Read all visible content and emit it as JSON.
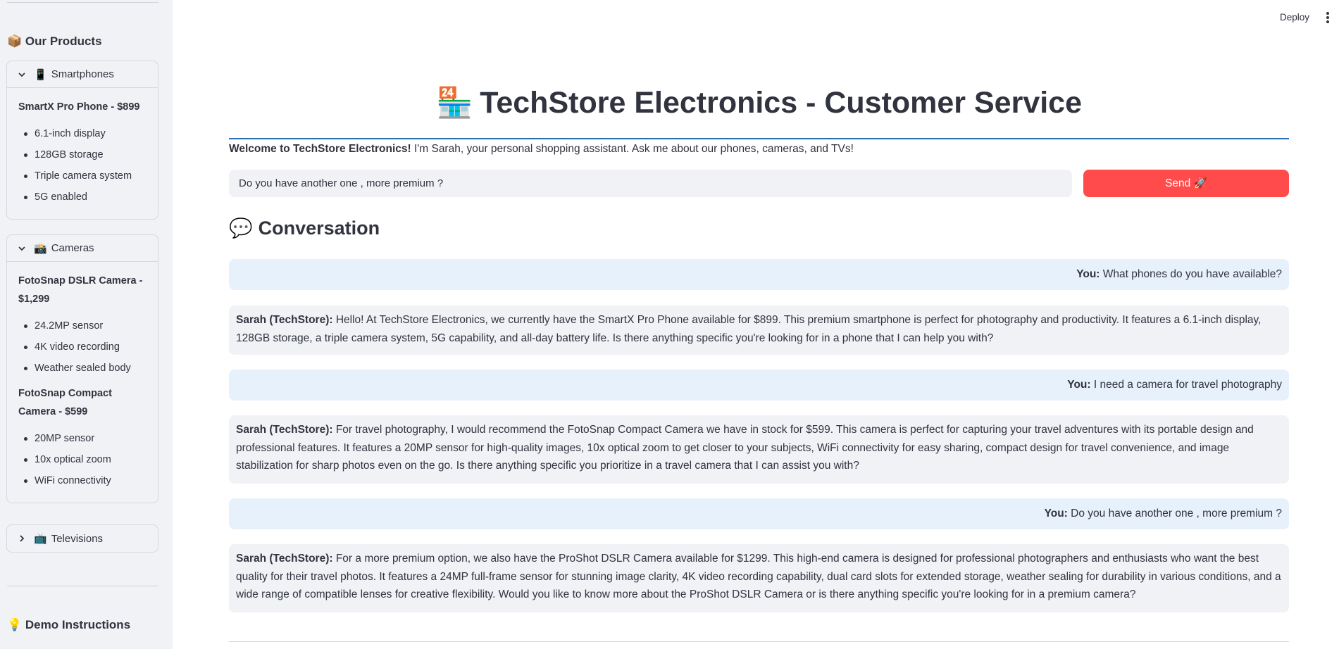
{
  "sidebar": {
    "products_heading_emoji": "📦",
    "products_heading": "Our Products",
    "expanders": [
      {
        "emoji": "📱",
        "label": "Smartphones",
        "expanded": true,
        "products": [
          {
            "title": "SmartX Pro Phone - $899",
            "features": [
              "6.1-inch display",
              "128GB storage",
              "Triple camera system",
              "5G enabled"
            ]
          }
        ]
      },
      {
        "emoji": "📸",
        "label": "Cameras",
        "expanded": true,
        "products": [
          {
            "title": "FotoSnap DSLR Camera - $1,299",
            "features": [
              "24.2MP sensor",
              "4K video recording",
              "Weather sealed body"
            ]
          },
          {
            "title": "FotoSnap Compact Camera - $599",
            "features": [
              "20MP sensor",
              "10x optical zoom",
              "WiFi connectivity"
            ]
          }
        ]
      },
      {
        "emoji": "📺",
        "label": "Televisions",
        "expanded": false
      }
    ],
    "demo_heading_emoji": "💡",
    "demo_heading": "Demo Instructions"
  },
  "toolbar": {
    "deploy_label": "Deploy"
  },
  "main": {
    "title_emoji": "🏪",
    "title": "TechStore Electronics - Customer Service",
    "welcome_bold": "Welcome to TechStore Electronics!",
    "welcome_text": " I'm Sarah, your personal shopping assistant. Ask me about our phones, cameras, and TVs!",
    "input_value": "Do you have another one , more premium ?",
    "send_label": "Send 🚀",
    "conversation_emoji": "💬",
    "conversation_heading": "Conversation",
    "messages": [
      {
        "role": "user",
        "speaker": "You:",
        "text": " What phones do you have available?"
      },
      {
        "role": "bot",
        "speaker": "Sarah (TechStore):",
        "text": " Hello! At TechStore Electronics, we currently have the SmartX Pro Phone available for $899. This premium smartphone is perfect for photography and productivity. It features a 6.1-inch display, 128GB storage, a triple camera system, 5G capability, and all-day battery life. Is there anything specific you're looking for in a phone that I can help you with?"
      },
      {
        "role": "user",
        "speaker": "You:",
        "text": " I need a camera for travel photography"
      },
      {
        "role": "bot",
        "speaker": "Sarah (TechStore):",
        "text": " For travel photography, I would recommend the FotoSnap Compact Camera we have in stock for $599. This camera is perfect for capturing your travel adventures with its portable design and professional features. It features a 20MP sensor for high-quality images, 10x optical zoom to get closer to your subjects, WiFi connectivity for easy sharing, compact design for travel convenience, and image stabilization for sharp photos even on the go. Is there anything specific you prioritize in a travel camera that I can assist you with?"
      },
      {
        "role": "user",
        "speaker": "You:",
        "text": " Do you have another one , more premium ?"
      },
      {
        "role": "bot",
        "speaker": "Sarah (TechStore):",
        "text": " For a more premium option, we also have the ProShot DSLR Camera available for $1299. This high-end camera is designed for professional photographers and enthusiasts who want the best quality for their travel photos. It features a 24MP full-frame sensor for stunning image clarity, 4K video recording capability, dual card slots for extended storage, weather sealing for durability in various conditions, and a wide range of compatible lenses for creative flexibility. Would you like to know more about the ProShot DSLR Camera or is there anything specific you're looking for in a premium camera?"
      }
    ]
  }
}
